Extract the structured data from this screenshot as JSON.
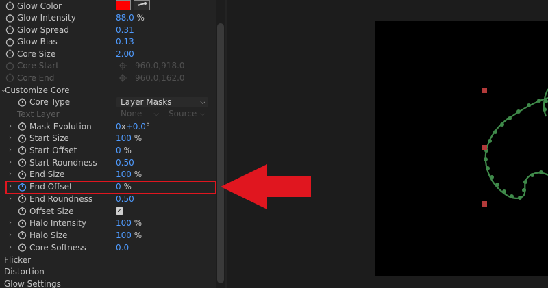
{
  "effect_controls": {
    "glow_color": {
      "label": "Glow Color",
      "swatch_color": "#ff0000"
    },
    "glow_intensity": {
      "label": "Glow Intensity",
      "value": "88.0",
      "unit": "%"
    },
    "glow_spread": {
      "label": "Glow Spread",
      "value": "0.31"
    },
    "glow_bias": {
      "label": "Glow Bias",
      "value": "0.13"
    },
    "core_size": {
      "label": "Core Size",
      "value": "2.00"
    },
    "core_start": {
      "label": "Core Start",
      "value": "960.0,918.0"
    },
    "core_end": {
      "label": "Core End",
      "value": "960.0,162.0"
    },
    "customize_core": {
      "label": "Customize Core",
      "core_type": {
        "label": "Core Type",
        "value": "Layer Masks"
      },
      "text_layer": {
        "label": "Text Layer",
        "value": "None",
        "source": "Source"
      },
      "mask_evolution": {
        "label": "Mask Evolution",
        "value_rev": "0",
        "rev_unit": "x",
        "value_deg": "+0.0",
        "deg_unit": "°"
      },
      "start_size": {
        "label": "Start Size",
        "value": "100",
        "unit": "%"
      },
      "start_offset": {
        "label": "Start Offset",
        "value": "0",
        "unit": "%"
      },
      "start_roundness": {
        "label": "Start Roundness",
        "value": "0.50"
      },
      "end_size": {
        "label": "End Size",
        "value": "100",
        "unit": "%"
      },
      "end_offset": {
        "label": "End Offset",
        "value": "0",
        "unit": "%"
      },
      "end_roundness": {
        "label": "End Roundness",
        "value": "0.50"
      },
      "offset_size": {
        "label": "Offset Size",
        "checked": true
      },
      "halo_intensity": {
        "label": "Halo Intensity",
        "value": "100",
        "unit": "%"
      },
      "halo_size": {
        "label": "Halo Size",
        "value": "100",
        "unit": "%"
      },
      "core_softness": {
        "label": "Core Softness",
        "value": "0.0"
      }
    },
    "groups": {
      "flicker": "Flicker",
      "distortion": "Distortion",
      "glow_settings": "Glow Settings"
    }
  },
  "annotation": {
    "highlight_color": "#e0161f",
    "arrow_color": "#e0161f"
  },
  "viewer": {
    "background": "#000000",
    "mask_color": "#3f8a4a",
    "handle_color": "#b23a3a"
  }
}
